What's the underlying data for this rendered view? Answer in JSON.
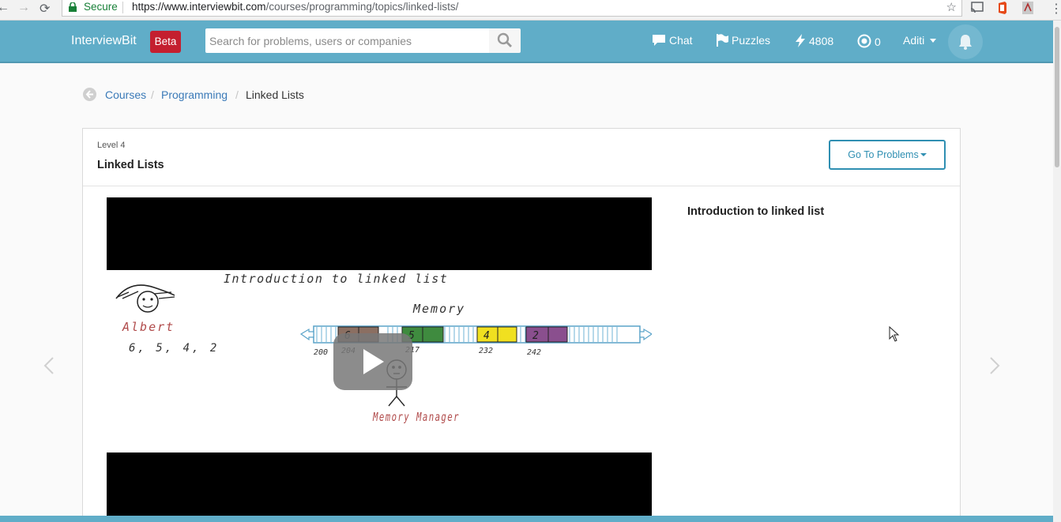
{
  "browser": {
    "secure_label": "Secure",
    "url_host": "https://www.interviewbit.com",
    "url_path": "/courses/programming/topics/linked-lists/"
  },
  "header": {
    "logo": "InterviewBit",
    "badge": "Beta",
    "search_placeholder": "Search for problems, users or companies",
    "chat": "Chat",
    "puzzles": "Puzzles",
    "score": "4808",
    "coins": "0",
    "user": "Aditi"
  },
  "breadcrumb": {
    "items": [
      "Courses",
      "Programming",
      "Linked Lists"
    ],
    "separator": "/"
  },
  "topic": {
    "level": "Level 4",
    "title": "Linked Lists",
    "goto_label": "Go To Problems"
  },
  "video": {
    "frame_title": "Introduction to linked list",
    "person": "Albert",
    "numbers": "6, 5, 4, 2",
    "memory_label": "Memory",
    "manager_label": "Memory Manager",
    "block_values": [
      "6",
      "5",
      "4",
      "2"
    ],
    "addresses": [
      "200",
      "204",
      "217",
      "232",
      "242"
    ]
  },
  "sidebar": {
    "title": "Introduction to linked list"
  },
  "colors": {
    "header_bg": "#60adc8",
    "beta_bg": "#c41f2f",
    "link": "#3a7ab8",
    "button_border": "#2f8fb2"
  }
}
